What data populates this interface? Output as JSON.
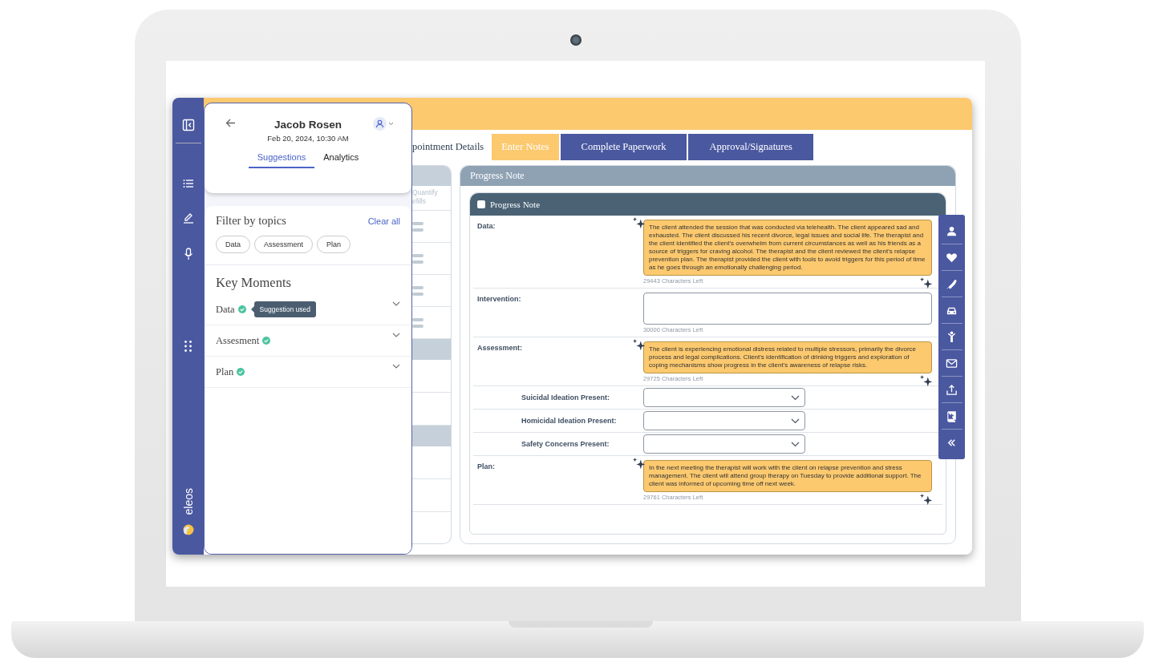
{
  "rail": {
    "brand": "eleos"
  },
  "panel": {
    "patient_name": "Jacob Rosen",
    "datetime": "Feb 20, 2024, 10:30 AM",
    "tabs": [
      {
        "label": "Suggestions",
        "selected": true
      },
      {
        "label": "Analytics",
        "selected": false
      }
    ],
    "filter": {
      "title": "Filter by topics",
      "clear": "Clear all",
      "chips": [
        "Data",
        "Assessment",
        "Plan"
      ]
    },
    "key_moments": {
      "title": "Key Moments",
      "items": [
        {
          "label": "Data",
          "used": true,
          "tooltip": "Suggestion used"
        },
        {
          "label": "Assesment",
          "used": true
        },
        {
          "label": "Plan",
          "used": true
        }
      ]
    }
  },
  "tabs": [
    {
      "label": "pointment Details",
      "selected": false,
      "done": true
    },
    {
      "label": "Enter Notes",
      "selected": true,
      "done": false
    },
    {
      "label": "Complete Paperwork",
      "selected": false,
      "done": false
    },
    {
      "label": "Approval/Signatures",
      "selected": false,
      "done": false
    }
  ],
  "left_table": {
    "header": [
      "Quantify",
      "efills"
    ]
  },
  "note": {
    "panel_title": "Progress Note",
    "card_title": "Progress Note",
    "checked": false,
    "fields": [
      {
        "kind": "text",
        "label": "Data:",
        "ai_filled": true,
        "value": "The client attended the session that was conducted via telehealth. The client appeared sad and exhausted. The client discussed his recent divorce, legal issues and social life. The therapist and the client identified the client's overwhelm from current circumstances as well as his friends as a source of triggers for craving alcohol. The therapist and the client reviewed the client's relapse prevention plan. The therapist provided the client with tools to avoid triggers for this period of time as he goes through an emotionally challenging period.",
        "counter": "29443 Characters Left"
      },
      {
        "kind": "text",
        "label": "Intervention:",
        "ai_filled": false,
        "counter": "30000 Characters Left"
      },
      {
        "kind": "text",
        "label": "Assessment:",
        "ai_filled": true,
        "value": "The client is experiencing emotional distress related to multiple stressors, primarily the divorce process and legal complications. Client's identification of drinking triggers and exploration of coping mechanisms show progress in the client's awareness of relapse risks.",
        "counter": "29725 Characters Left"
      },
      {
        "kind": "select",
        "label": "Suicidal Ideation Present:"
      },
      {
        "kind": "select",
        "label": "Homicidal Ideation Present:"
      },
      {
        "kind": "select",
        "label": "Safety Concerns Present:"
      },
      {
        "kind": "text",
        "label": "Plan:",
        "ai_filled": true,
        "value": "In the next meeting the therapist will work with the client on relapse prevention and stress management. The client will attend group therapy on Tuesday to provide additional support. The client was informed of upcoming time off next week.",
        "counter": "29761 Characters Left"
      }
    ]
  }
}
